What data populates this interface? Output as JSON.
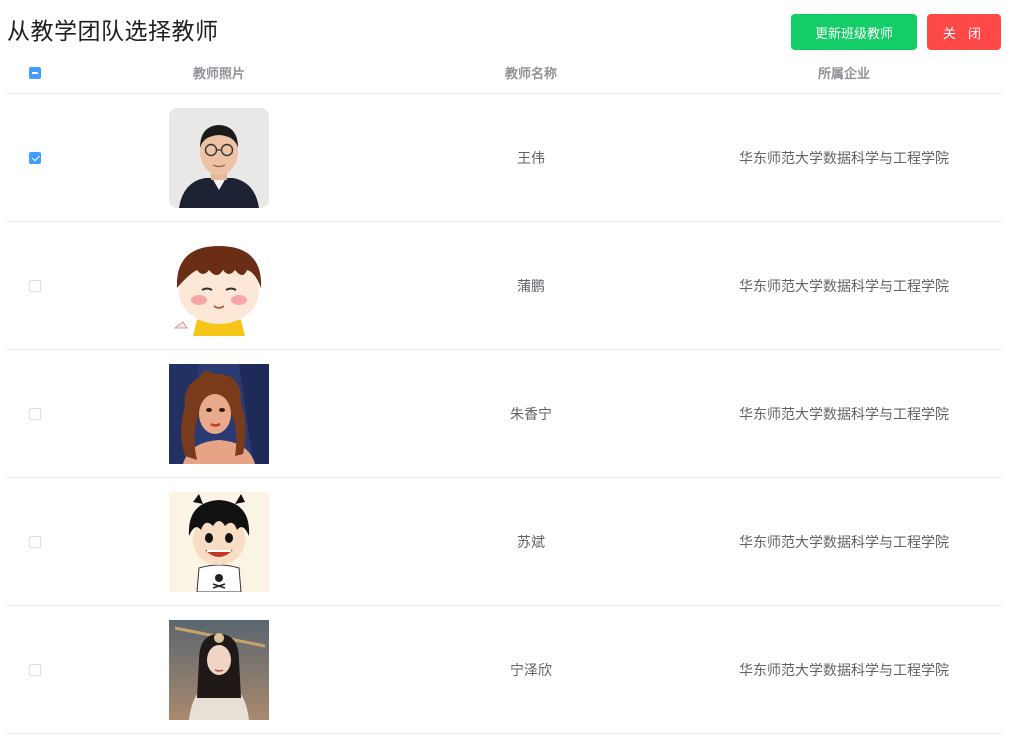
{
  "header": {
    "title": "从教学团队选择教师",
    "update_button": "更新班级教师",
    "close_button": "关 闭"
  },
  "table": {
    "select_all_state": "indeterminate",
    "columns": [
      "教师照片",
      "教师名称",
      "所属企业"
    ],
    "rows": [
      {
        "checked": true,
        "photo": "portrait-man-glasses",
        "name": "王伟",
        "org": "华东师范大学数据科学与工程学院"
      },
      {
        "checked": false,
        "photo": "cartoon-boy",
        "name": "蒲鹏",
        "org": "华东师范大学数据科学与工程学院"
      },
      {
        "checked": false,
        "photo": "cartoon-princess",
        "name": "朱香宁",
        "org": "华东师范大学数据科学与工程学院"
      },
      {
        "checked": false,
        "photo": "cartoon-luffy",
        "name": "苏斌",
        "org": "华东师范大学数据科学与工程学院"
      },
      {
        "checked": false,
        "photo": "photo-woman-costume",
        "name": "宁泽欣",
        "org": "华东师范大学数据科学与工程学院"
      }
    ]
  },
  "colors": {
    "update_button": "#13ce66",
    "close_button": "#ff4949",
    "checkbox_active": "#409eff",
    "border": "#ebeef5"
  }
}
